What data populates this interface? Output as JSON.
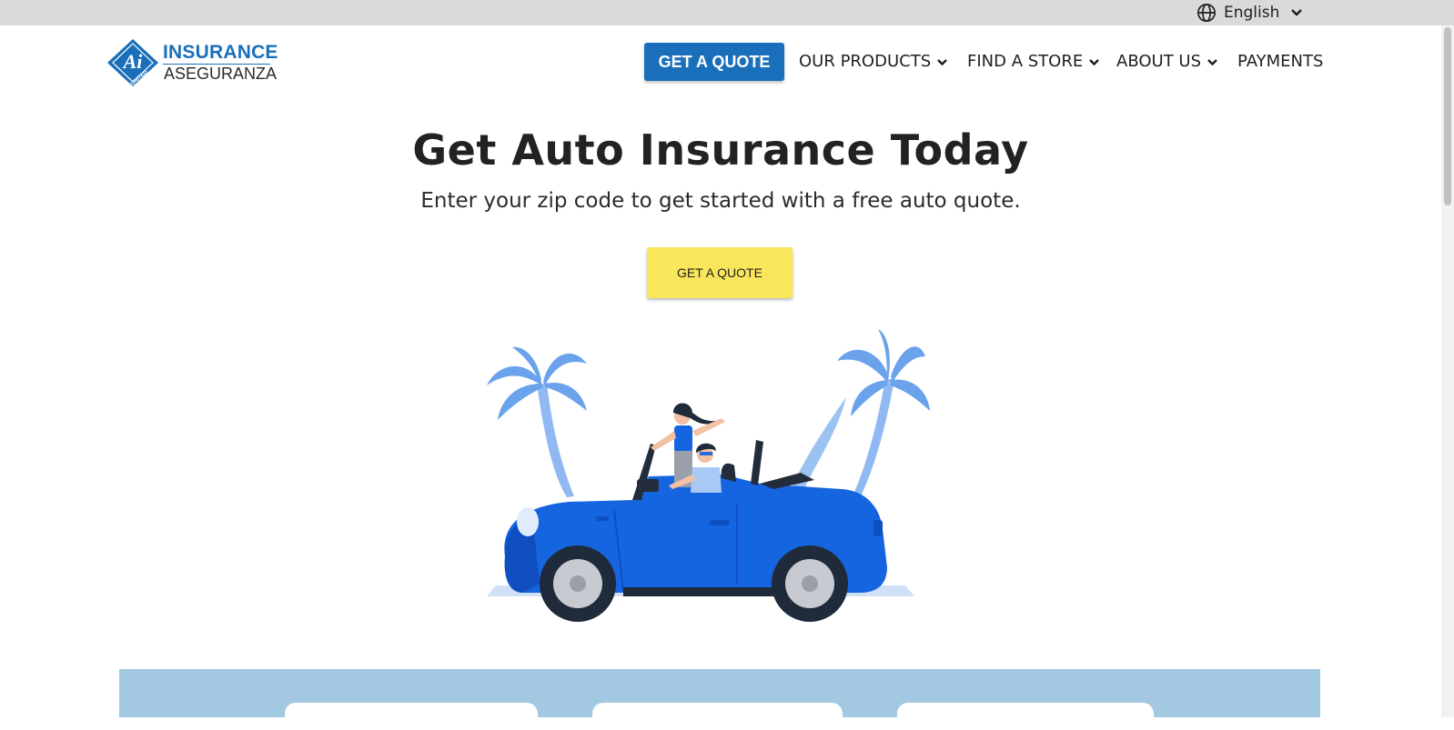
{
  "language_selector": {
    "label": "English",
    "icon": "globe-icon",
    "caret_icon": "chevron-down-icon"
  },
  "logo": {
    "badge_text": "Ai",
    "badge_subtext": "UNITED",
    "word1": "INSURANCE",
    "word2": "ASEGURANZA"
  },
  "nav": {
    "quote_button": "GET A QUOTE",
    "items": [
      {
        "label": "OUR PRODUCTS",
        "has_dropdown": true
      },
      {
        "label": "FIND A STORE",
        "has_dropdown": true
      },
      {
        "label": "ABOUT US",
        "has_dropdown": true
      },
      {
        "label": "PAYMENTS",
        "has_dropdown": false
      }
    ]
  },
  "hero": {
    "title": "Get Auto Insurance Today",
    "subtitle": "Enter your zip code to get started with a free auto quote.",
    "cta": "GET A QUOTE",
    "illustration": "convertible-car-palm-trees-illustration"
  },
  "colors": {
    "brand_blue": "#1a6fba",
    "cta_yellow": "#fae65a",
    "top_bar": "#dadada",
    "band_blue": "#a2c8e2",
    "car_blue": "#1565e0"
  }
}
